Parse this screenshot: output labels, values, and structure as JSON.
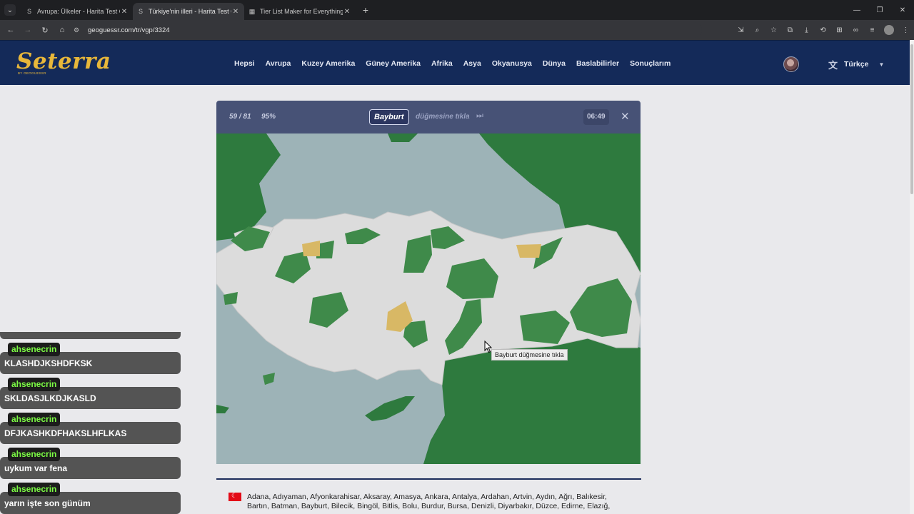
{
  "browser": {
    "tabs": [
      {
        "title": "Avrupa: Ülkeler - Harita Test Oyunu",
        "active": false,
        "icon": "seterra-icon"
      },
      {
        "title": "Türkiye'nin illeri - Harita Test Oyunu",
        "active": true,
        "icon": "seterra-icon"
      },
      {
        "title": "Tier List Maker for Everything - TierMaker",
        "active": false,
        "icon": "tiermaker-icon"
      }
    ],
    "url": "geoguessr.com/tr/vgp/3324"
  },
  "site": {
    "logo": "Seterra",
    "logo_sub": "BY GEOGUESSR",
    "nav": [
      "Hepsi",
      "Avrupa",
      "Kuzey Amerika",
      "Güney Amerika",
      "Afrika",
      "Asya",
      "Okyanusya",
      "Dünya",
      "Baslabilirler",
      "Sonuçlarım"
    ],
    "language": "Türkçe"
  },
  "game": {
    "counter": "59 / 81",
    "percent": "95%",
    "target": "Bayburt",
    "instruction": "düğmesine tıkla",
    "timer": "06:49"
  },
  "tooltip": "Bayburt düğmesine tıkla",
  "province_list": "Adana, Adıyaman, Afyonkarahisar, Aksaray, Amasya, Ankara, Antalya, Ardahan, Artvin, Aydın, Ağrı, Balıkesir, Bartın, Batman, Bayburt, Bilecik, Bingöl, Bitlis, Bolu, Burdur, Bursa, Denizli, Diyarbakır, Düzce, Edirne, Elazığ,",
  "chat": [
    {
      "user": "ahsenecrin",
      "message": "KLASHDJKSHDFKSK"
    },
    {
      "user": "ahsenecrin",
      "message": "SKLDASJLKDJKASLD"
    },
    {
      "user": "ahsenecrin",
      "message": "DFJKASHKDFHAKSLHFLKAS"
    },
    {
      "user": "ahsenecrin",
      "message": "uykum var fena"
    },
    {
      "user": "ahsenecrin",
      "message": "yarın işte son günüm"
    }
  ],
  "colors": {
    "header_bg": "#142a59",
    "logo": "#e8b73a",
    "map_sea": "#9db3b7",
    "map_land": "#dcdcdc",
    "map_correct": "#3f8a4a",
    "map_neighbor": "#2e7a3e",
    "map_missed": "#d8b865",
    "chat_name": "#7cfc44"
  }
}
